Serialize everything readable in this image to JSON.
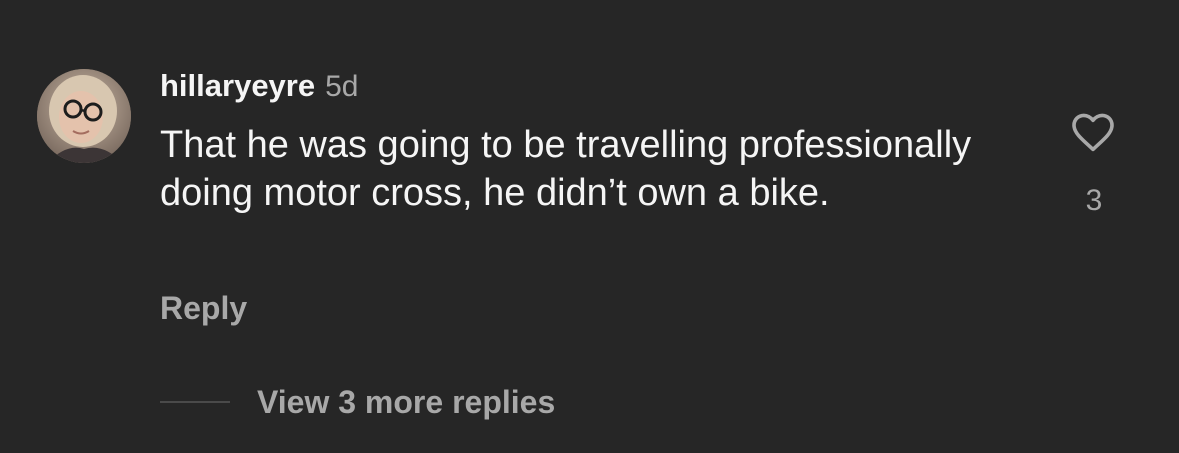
{
  "comment": {
    "username": "hillaryeyre",
    "timestamp": "5d",
    "text": "That he was going to be travelling professionally doing motor cross, he didn’t own a bike.",
    "reply_label": "Reply",
    "like_count": "3",
    "view_replies_label": "View 3 more replies"
  },
  "icons": {
    "like": "heart-outline-icon"
  },
  "colors": {
    "background": "#262626",
    "primary_text": "#f5f5f5",
    "secondary_text": "#a8a8a8"
  }
}
